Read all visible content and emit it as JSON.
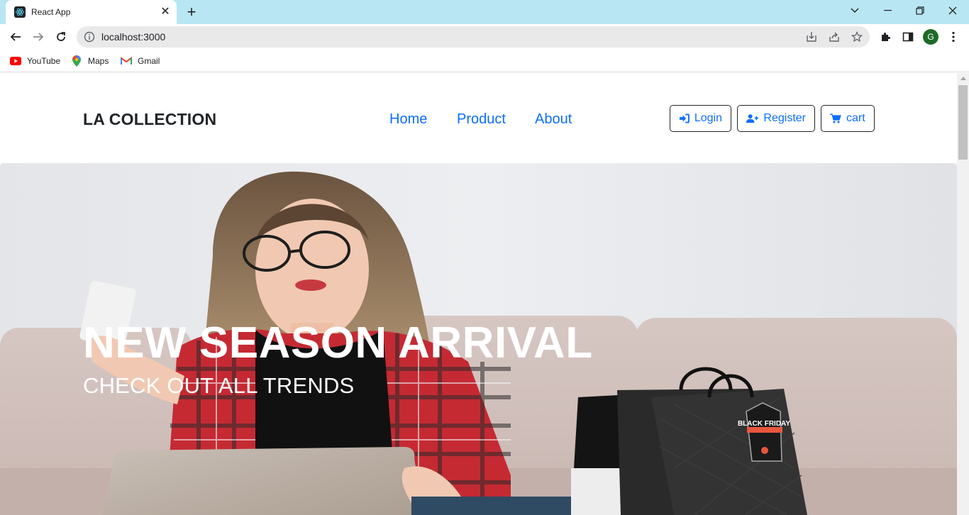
{
  "browser": {
    "tab_title": "React App",
    "url": "localhost:3000",
    "avatar_initial": "G",
    "bookmarks": [
      {
        "label": "YouTube",
        "icon": "youtube-icon"
      },
      {
        "label": "Maps",
        "icon": "maps-icon"
      },
      {
        "label": "Gmail",
        "icon": "gmail-icon"
      }
    ]
  },
  "site": {
    "brand": "LA COLLECTION",
    "nav": [
      {
        "label": "Home"
      },
      {
        "label": "Product"
      },
      {
        "label": "About"
      }
    ],
    "buttons": {
      "login": "Login",
      "register": "Register",
      "cart": "cart"
    }
  },
  "hero": {
    "title": "NEW SEASON ARRIVAL",
    "subtitle": "CHECK OUT ALL TRENDS",
    "tag_text": "BLACK FRIDAY"
  },
  "colors": {
    "link": "#0d6efd",
    "tabstrip": "#b8e6f3",
    "brand_text": "#212529"
  }
}
